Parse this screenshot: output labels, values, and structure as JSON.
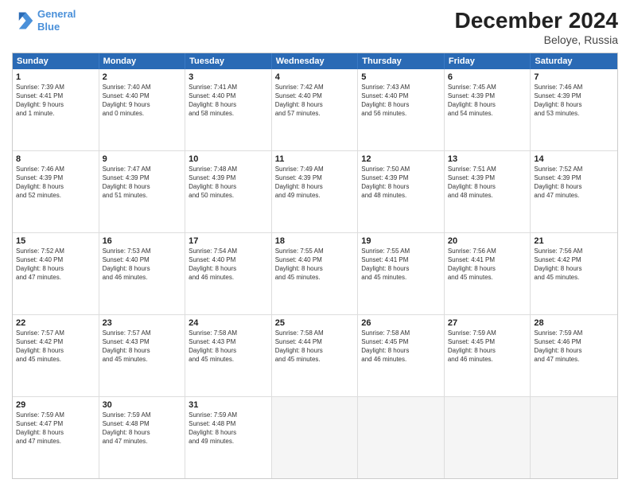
{
  "logo": {
    "text_general": "General",
    "text_blue": "Blue"
  },
  "title": "December 2024",
  "subtitle": "Beloye, Russia",
  "days": [
    "Sunday",
    "Monday",
    "Tuesday",
    "Wednesday",
    "Thursday",
    "Friday",
    "Saturday"
  ],
  "weeks": [
    [
      {
        "num": "1",
        "lines": [
          "Sunrise: 7:39 AM",
          "Sunset: 4:41 PM",
          "Daylight: 9 hours",
          "and 1 minute."
        ]
      },
      {
        "num": "2",
        "lines": [
          "Sunrise: 7:40 AM",
          "Sunset: 4:40 PM",
          "Daylight: 9 hours",
          "and 0 minutes."
        ]
      },
      {
        "num": "3",
        "lines": [
          "Sunrise: 7:41 AM",
          "Sunset: 4:40 PM",
          "Daylight: 8 hours",
          "and 58 minutes."
        ]
      },
      {
        "num": "4",
        "lines": [
          "Sunrise: 7:42 AM",
          "Sunset: 4:40 PM",
          "Daylight: 8 hours",
          "and 57 minutes."
        ]
      },
      {
        "num": "5",
        "lines": [
          "Sunrise: 7:43 AM",
          "Sunset: 4:40 PM",
          "Daylight: 8 hours",
          "and 56 minutes."
        ]
      },
      {
        "num": "6",
        "lines": [
          "Sunrise: 7:45 AM",
          "Sunset: 4:39 PM",
          "Daylight: 8 hours",
          "and 54 minutes."
        ]
      },
      {
        "num": "7",
        "lines": [
          "Sunrise: 7:46 AM",
          "Sunset: 4:39 PM",
          "Daylight: 8 hours",
          "and 53 minutes."
        ]
      }
    ],
    [
      {
        "num": "8",
        "lines": [
          "Sunrise: 7:46 AM",
          "Sunset: 4:39 PM",
          "Daylight: 8 hours",
          "and 52 minutes."
        ]
      },
      {
        "num": "9",
        "lines": [
          "Sunrise: 7:47 AM",
          "Sunset: 4:39 PM",
          "Daylight: 8 hours",
          "and 51 minutes."
        ]
      },
      {
        "num": "10",
        "lines": [
          "Sunrise: 7:48 AM",
          "Sunset: 4:39 PM",
          "Daylight: 8 hours",
          "and 50 minutes."
        ]
      },
      {
        "num": "11",
        "lines": [
          "Sunrise: 7:49 AM",
          "Sunset: 4:39 PM",
          "Daylight: 8 hours",
          "and 49 minutes."
        ]
      },
      {
        "num": "12",
        "lines": [
          "Sunrise: 7:50 AM",
          "Sunset: 4:39 PM",
          "Daylight: 8 hours",
          "and 48 minutes."
        ]
      },
      {
        "num": "13",
        "lines": [
          "Sunrise: 7:51 AM",
          "Sunset: 4:39 PM",
          "Daylight: 8 hours",
          "and 48 minutes."
        ]
      },
      {
        "num": "14",
        "lines": [
          "Sunrise: 7:52 AM",
          "Sunset: 4:39 PM",
          "Daylight: 8 hours",
          "and 47 minutes."
        ]
      }
    ],
    [
      {
        "num": "15",
        "lines": [
          "Sunrise: 7:52 AM",
          "Sunset: 4:40 PM",
          "Daylight: 8 hours",
          "and 47 minutes."
        ]
      },
      {
        "num": "16",
        "lines": [
          "Sunrise: 7:53 AM",
          "Sunset: 4:40 PM",
          "Daylight: 8 hours",
          "and 46 minutes."
        ]
      },
      {
        "num": "17",
        "lines": [
          "Sunrise: 7:54 AM",
          "Sunset: 4:40 PM",
          "Daylight: 8 hours",
          "and 46 minutes."
        ]
      },
      {
        "num": "18",
        "lines": [
          "Sunrise: 7:55 AM",
          "Sunset: 4:40 PM",
          "Daylight: 8 hours",
          "and 45 minutes."
        ]
      },
      {
        "num": "19",
        "lines": [
          "Sunrise: 7:55 AM",
          "Sunset: 4:41 PM",
          "Daylight: 8 hours",
          "and 45 minutes."
        ]
      },
      {
        "num": "20",
        "lines": [
          "Sunrise: 7:56 AM",
          "Sunset: 4:41 PM",
          "Daylight: 8 hours",
          "and 45 minutes."
        ]
      },
      {
        "num": "21",
        "lines": [
          "Sunrise: 7:56 AM",
          "Sunset: 4:42 PM",
          "Daylight: 8 hours",
          "and 45 minutes."
        ]
      }
    ],
    [
      {
        "num": "22",
        "lines": [
          "Sunrise: 7:57 AM",
          "Sunset: 4:42 PM",
          "Daylight: 8 hours",
          "and 45 minutes."
        ]
      },
      {
        "num": "23",
        "lines": [
          "Sunrise: 7:57 AM",
          "Sunset: 4:43 PM",
          "Daylight: 8 hours",
          "and 45 minutes."
        ]
      },
      {
        "num": "24",
        "lines": [
          "Sunrise: 7:58 AM",
          "Sunset: 4:43 PM",
          "Daylight: 8 hours",
          "and 45 minutes."
        ]
      },
      {
        "num": "25",
        "lines": [
          "Sunrise: 7:58 AM",
          "Sunset: 4:44 PM",
          "Daylight: 8 hours",
          "and 45 minutes."
        ]
      },
      {
        "num": "26",
        "lines": [
          "Sunrise: 7:58 AM",
          "Sunset: 4:45 PM",
          "Daylight: 8 hours",
          "and 46 minutes."
        ]
      },
      {
        "num": "27",
        "lines": [
          "Sunrise: 7:59 AM",
          "Sunset: 4:45 PM",
          "Daylight: 8 hours",
          "and 46 minutes."
        ]
      },
      {
        "num": "28",
        "lines": [
          "Sunrise: 7:59 AM",
          "Sunset: 4:46 PM",
          "Daylight: 8 hours",
          "and 47 minutes."
        ]
      }
    ],
    [
      {
        "num": "29",
        "lines": [
          "Sunrise: 7:59 AM",
          "Sunset: 4:47 PM",
          "Daylight: 8 hours",
          "and 47 minutes."
        ]
      },
      {
        "num": "30",
        "lines": [
          "Sunrise: 7:59 AM",
          "Sunset: 4:48 PM",
          "Daylight: 8 hours",
          "and 47 minutes."
        ]
      },
      {
        "num": "31",
        "lines": [
          "Sunrise: 7:59 AM",
          "Sunset: 4:48 PM",
          "Daylight: 8 hours",
          "and 49 minutes."
        ]
      },
      {
        "num": "",
        "lines": []
      },
      {
        "num": "",
        "lines": []
      },
      {
        "num": "",
        "lines": []
      },
      {
        "num": "",
        "lines": []
      }
    ]
  ]
}
